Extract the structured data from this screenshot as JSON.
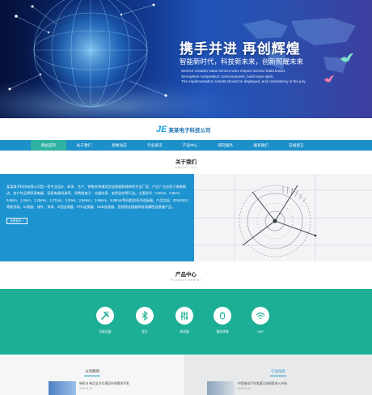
{
  "colors": {
    "nav_bg": "#1d8fc9",
    "nav_active": "#2fb1a2",
    "about_bg": "#1d93d0",
    "product_band": "#1caf96",
    "accent_blue": "#1a6fb0"
  },
  "hero": {
    "title": "携手并进  再创辉煌",
    "subtitle": "智能新时代，科技新未来，创新照耀未来",
    "english_lines": [
      "Service creation value service wins respect service build brand.",
      "Strengthen competition consciousness, build team spirit.",
      "The implementation results should be displayed, and consistency is the jury."
    ]
  },
  "logo": {
    "mark": "JE",
    "company_name": "某某电子科技公司"
  },
  "nav": {
    "items": [
      "网站首页",
      "关于我们",
      "新闻动态",
      "行业资讯",
      "产品中心",
      "研究服务",
      "联系我们",
      "在线留言"
    ],
    "active_index": 0
  },
  "about": {
    "title": "关于我们",
    "subtitle": "ABOUT US",
    "text": "某某电子科技有限公司是一家专业设计、研发、生产、销售各种通用型连接器和线束的专业厂家，产品广泛应用于电脑周边、各户外品牌家用电器、家庭电器用具等、消费类电子、仪器仪表、安防监控等行业。主要型号：0.5mm、0.6mm、0.8mm、1.0mm、1.25mm、1.27mm、2.0mm、2.54mm、3.96mm、5.08mm等间距的系列连接器。产品包括：DIN41612等矩形板、IC插座、排针、排母、D型连接器、FPC连接器、USB连接器、音视频连接器等各类精密连接器产品。",
    "more_label": "查看更多 >"
  },
  "products": {
    "title": "产品中心",
    "subtitle": "Product center",
    "items": [
      {
        "label": "功能设备",
        "icon": "tools-icon"
      },
      {
        "label": "蓝牙",
        "icon": "bluetooth-icon"
      },
      {
        "label": "调试器",
        "icon": "equalizer-icon"
      },
      {
        "label": "通信终端",
        "icon": "mouse-icon"
      },
      {
        "label": "WiFi",
        "icon": "wifi-icon"
      }
    ]
  },
  "news": {
    "left_title": "公司新闻",
    "right_title": "行业动态",
    "left_item": {
      "title": "新机台 新品全方位满足市场需求开发",
      "date": "2019-01-02"
    },
    "right_item": {
      "title": "中国电动汽车发展已由研发进入市场",
      "date": "2019-01-02"
    }
  }
}
